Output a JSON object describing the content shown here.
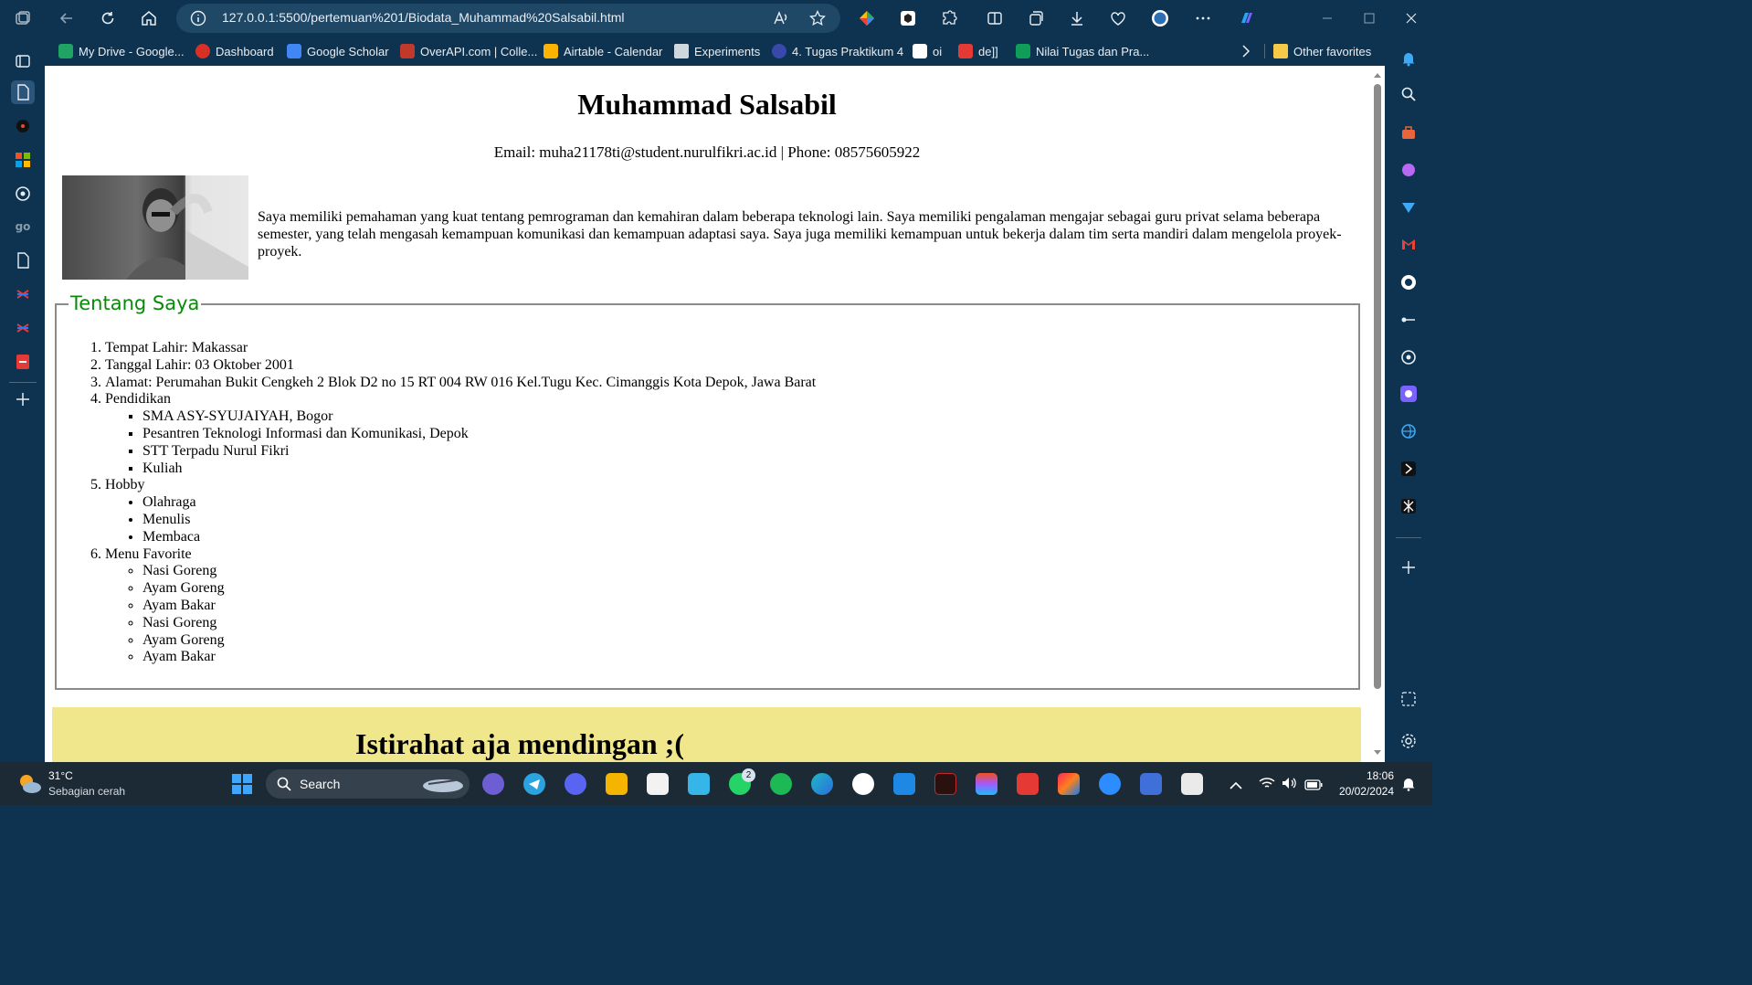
{
  "browser": {
    "url": "127.0.0.1:5500/pertemuan%201/Biodata_Muhammad%20Salsabil.html",
    "bookmarks": [
      {
        "label": "My Drive - Google...",
        "color": "#1fa463"
      },
      {
        "label": "Dashboard",
        "color": "#d93025"
      },
      {
        "label": "Google Scholar",
        "color": "#4285f4"
      },
      {
        "label": "OverAPI.com | Colle...",
        "color": "#c0392b"
      },
      {
        "label": "Airtable - Calendar",
        "color": "#fcb400"
      },
      {
        "label": "Experiments",
        "color": "#cfd8dc"
      },
      {
        "label": "4. Tugas Praktikum 4",
        "color": "#3949ab"
      },
      {
        "label": "oi",
        "color": "#ffffff"
      },
      {
        "label": "de]]",
        "color": "#e53935"
      },
      {
        "label": "Nilai Tugas dan Pra...",
        "color": "#0f9d58"
      }
    ],
    "other_favorites": "Other favorites"
  },
  "page": {
    "name": "Muhammad Salsabil",
    "contact": "Email: muha21178ti@student.nurulfikri.ac.id | Phone: 08575605922",
    "bio": "Saya memiliki pemahaman yang kuat tentang pemrograman dan kemahiran dalam beberapa teknologi lain. Saya memiliki pengalaman mengajar sebagai guru privat selama beberapa semester, yang telah mengasah kemampuan komunikasi dan kemampuan adaptasi saya. Saya juga memiliki kemampuan untuk bekerja dalam tim serta mandiri dalam mengelola proyek-proyek.",
    "about_title": "Tentang Saya",
    "items": {
      "tempat": "Tempat Lahir: Makassar",
      "tanggal": "Tanggal Lahir: 03 Oktober 2001",
      "alamat": "Alamat: Perumahan Bukit Cengkeh 2 Blok D2 no 15 RT 004 RW 016 Kel.Tugu Kec. Cimanggis Kota Depok, Jawa Barat",
      "pendidikan": "Pendidikan",
      "pendidikan_list": [
        "SMA ASY-SYUJAIYAH, Bogor",
        "Pesantren Teknologi Informasi dan Komunikasi, Depok",
        "STT Terpadu Nurul Fikri",
        "Kuliah"
      ],
      "hobby": "Hobby",
      "hobby_list": [
        "Olahraga",
        "Menulis",
        "Membaca"
      ],
      "menu": "Menu Favorite",
      "menu_list": [
        "Nasi Goreng",
        "Ayam Goreng",
        "Ayam Bakar",
        "Nasi Goreng",
        "Ayam Goreng",
        "Ayam Bakar"
      ]
    },
    "banner": "Istirahat aja mendingan ;("
  },
  "taskbar": {
    "weather_temp": "31°C",
    "weather_desc": "Sebagian cerah",
    "search_label": "Search",
    "whatsapp_badge": "2",
    "time": "18:06",
    "date": "20/02/2024"
  }
}
